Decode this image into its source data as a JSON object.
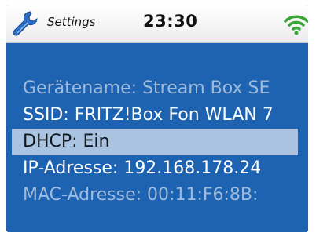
{
  "status_bar": {
    "app_icon": "wrench-icon",
    "title": "Settings",
    "time": "23:30",
    "signal_icon": "wifi-icon"
  },
  "settings_list": {
    "items": [
      {
        "label": "Gerätename: Stream Box SE"
      },
      {
        "label": "SSID: FRITZ!Box Fon WLAN 7"
      },
      {
        "label": "DHCP: Ein",
        "selected": true
      },
      {
        "label": "IP-Adresse: 192.168.178.24"
      },
      {
        "label": "MAC-Adresse: 00:11:F6:8B:"
      }
    ]
  },
  "colors": {
    "screen_background": "#1d63b1",
    "selection_highlight": "#a9c3e1",
    "wifi_green": "#3aa537",
    "wrench_blue": "#2b6cc4"
  }
}
